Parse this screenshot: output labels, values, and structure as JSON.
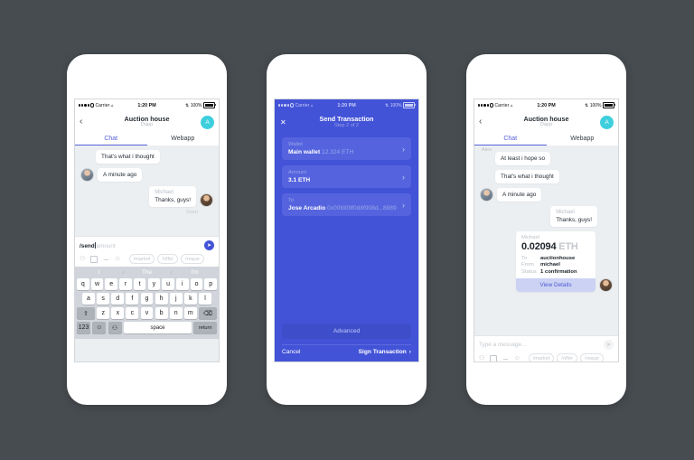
{
  "background_color": "#474c50",
  "status_bar": {
    "carrier": "Carrier",
    "time": "1:20 PM",
    "battery": "100%"
  },
  "phone1": {
    "header": {
      "back_icon": "‹",
      "title": "Auction house",
      "subtitle": "Dapp",
      "avatar_initial": "A"
    },
    "tabs": [
      {
        "label": "Chat",
        "active": true
      },
      {
        "label": "Webapp",
        "active": false
      }
    ],
    "messages": [
      {
        "sender": "",
        "text": "That's what i thought",
        "side": "left",
        "avatar": false
      },
      {
        "sender": "",
        "text": "A minute ago",
        "side": "left",
        "avatar": true
      },
      {
        "sender": "Michael",
        "text": "Thanks, guys!",
        "side": "right",
        "avatar": true
      }
    ],
    "seen_label": "Seen",
    "composer": {
      "command": "/send",
      "placeholder": "amount",
      "send_icon": "send-icon",
      "icons": [
        "microphone-icon",
        "camera-icon",
        "attachment-icon",
        "emoji-icon"
      ],
      "chips": [
        "/market",
        "/offer",
        "/reque"
      ]
    },
    "keyboard": {
      "suggestions": [
        "I",
        "The",
        "I'm"
      ],
      "row1": [
        "q",
        "w",
        "e",
        "r",
        "t",
        "y",
        "u",
        "i",
        "o",
        "p"
      ],
      "row2": [
        "a",
        "s",
        "d",
        "f",
        "g",
        "h",
        "j",
        "k",
        "l"
      ],
      "row3": [
        "z",
        "x",
        "c",
        "v",
        "b",
        "n",
        "m"
      ],
      "shift_key": "⇧",
      "delete_key": "⌫",
      "numeric_key": "123",
      "emoji_key": "☺",
      "mic_key": "🎤",
      "space_key": "space",
      "return_key": "return"
    }
  },
  "phone2": {
    "header": {
      "close_icon": "✕",
      "title": "Send Transaction",
      "subtitle": "Step 2 of 2"
    },
    "fields": [
      {
        "label": "Wallet",
        "value": "Main wallet",
        "extra": "12.324 ETH"
      },
      {
        "label": "Amount",
        "value": "3.1 ETH",
        "extra": ""
      },
      {
        "label": "To",
        "value": "Jose Arcadio",
        "extra": "0x00fd09f0d8f908d...8989"
      }
    ],
    "advanced_label": "Advanced",
    "cancel_label": "Cancel",
    "sign_label": "Sign Transaction",
    "chevron_icon": "›"
  },
  "phone3": {
    "header": {
      "back_icon": "‹",
      "title": "Auction house",
      "subtitle": "Dapp",
      "avatar_initial": "A"
    },
    "tabs": [
      {
        "label": "Chat",
        "active": true
      },
      {
        "label": "Webapp",
        "active": false
      }
    ],
    "partial_sender": "Alex",
    "messages": [
      {
        "sender": "",
        "text": "At least i hope so",
        "side": "left",
        "avatar": false
      },
      {
        "sender": "",
        "text": "That's what i thought",
        "side": "left",
        "avatar": false
      },
      {
        "sender": "",
        "text": "A minute ago",
        "side": "left",
        "avatar": true
      },
      {
        "sender": "Michael",
        "text": "Thanks, guys!",
        "side": "right",
        "avatar": false
      }
    ],
    "transaction_card": {
      "sender": "Michael",
      "amount": "0.02094",
      "currency": "ETH",
      "rows": [
        {
          "key": "To",
          "value": "auctionhouse"
        },
        {
          "key": "From",
          "value": "michael"
        },
        {
          "key": "Status",
          "value": "1 confirmation"
        }
      ],
      "button_label": "View Details"
    },
    "composer": {
      "placeholder": "Type a message...",
      "send_icon": "send-icon",
      "icons": [
        "microphone-icon",
        "camera-icon",
        "attachment-icon",
        "emoji-icon"
      ],
      "chips": [
        "/market",
        "/offer",
        "/reque"
      ]
    }
  }
}
